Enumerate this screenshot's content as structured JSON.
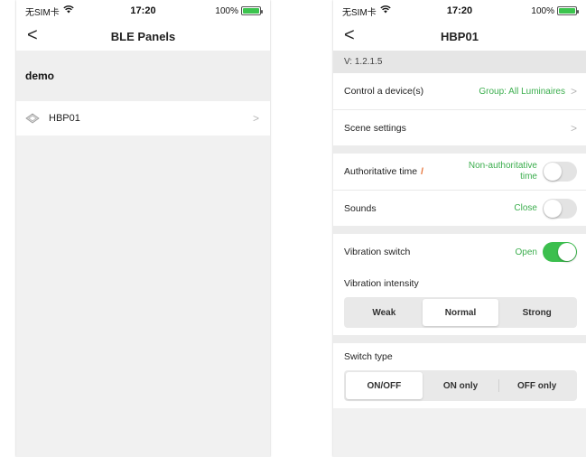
{
  "left": {
    "status": {
      "carrier": "无SIM卡",
      "time": "17:20",
      "battery": "100%"
    },
    "nav": {
      "back": "<",
      "title": "BLE Panels"
    },
    "group": {
      "name": "demo"
    },
    "items": [
      {
        "label": "HBP01"
      }
    ]
  },
  "right": {
    "status": {
      "carrier": "无SIM卡",
      "time": "17:20",
      "battery": "100%"
    },
    "nav": {
      "back": "<",
      "title": "HBP01"
    },
    "version": "V: 1.2.1.5",
    "control": {
      "label": "Control a device(s)",
      "value": "Group: All Luminaires"
    },
    "scene": {
      "label": "Scene settings"
    },
    "auth_time": {
      "label": "Authoritative time",
      "value": "Non-authoritative time",
      "on": false
    },
    "sounds": {
      "label": "Sounds",
      "value": "Close",
      "on": false
    },
    "vibration": {
      "label": "Vibration switch",
      "value": "Open",
      "on": true
    },
    "intensity": {
      "label": "Vibration intensity",
      "options": [
        "Weak",
        "Normal",
        "Strong"
      ],
      "selected": "Normal"
    },
    "switch_type": {
      "label": "Switch type",
      "options": [
        "ON/OFF",
        "ON only",
        "OFF only"
      ],
      "selected": "ON/OFF"
    }
  },
  "colors": {
    "accent_green": "#3cae4e",
    "toggle_on": "#3cbf4e",
    "edit_orange": "#e56a2b"
  },
  "icons": {
    "back": "chevron-left-icon",
    "device": "panel-device-icon",
    "chevron": "chevron-right-icon",
    "edit": "pencil-icon",
    "wifi": "wifi-icon",
    "battery": "battery-icon"
  }
}
